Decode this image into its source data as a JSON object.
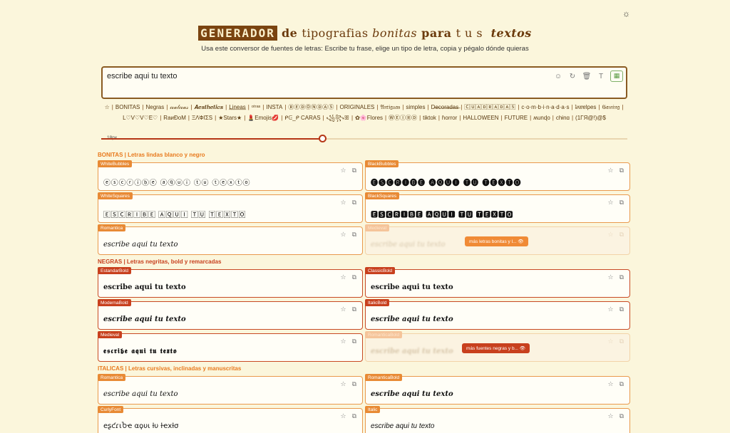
{
  "theme_icon": "☼",
  "header": {
    "title_boxed": "GENERADOR",
    "title_de": " de ",
    "title_tipografias": "tipografias ",
    "title_bonitas": "bonitas",
    "title_para": " para ",
    "title_tus": "tus",
    "title_textos": " textos",
    "subtitle": "Usa este conversor de fuentes de letras: Escribe tu frase, elige un tipo de letra, copia y pégalo dónde quieras"
  },
  "input": {
    "value": "escribe aqui tu texto",
    "tools": [
      "☺",
      "↻",
      "🗑",
      "T",
      "▦"
    ]
  },
  "categories": [
    "☆",
    "BONITAS",
    "Negras",
    "𝒾𝒸𝒶𝓁𝒾𝒸𝒶𝓈",
    "𝑨𝒆𝒔𝒕𝒉𝒆𝒕𝒊𝒄𝒔",
    "L̲i̲n̲e̲a̲s̲",
    "ᵒᵗʳᵃˢ",
    "INSTA",
    "ⓇⒺⒹⓄⓃⒹⒶⓈ",
    "ORIGINALES",
    "𝔄𝔫𝔱𝔦𝔤𝔲𝔞𝔰",
    "simples",
    "D̶e̶c̶o̶r̶a̶d̶a̶s̶",
    "🄲🅄🄰🄳🅁🄰🄳🄰🅂",
    "c·o·m·b·i·n·a·d·a·s",
    "ʇʌɐɐlpes",
    "𝔊𝔞𝔪𝔦𝔫𝔤",
    "L♡V♡V♡E♡",
    "RaиÐoM",
    "ΞΛ̇ФΙ̇ΣS",
    "★Stars★",
    "💄Emojis💋",
    "ᑭᕮ_ᑭ CARAS",
    "꧁꧂ꕥ",
    "✿🌸Flores",
    "ⓌⒺⒾⓇⒹ",
    "tiktok",
    "ɦorror",
    "HALLOWEEN",
    "FUTURE",
    "ʍunɖo",
    "chɨnɑ",
    "(1ΓЯ@!)@$"
  ],
  "slider": {
    "label": "18px",
    "value": 18,
    "fraction": 0.42
  },
  "sections": {
    "bonitas": "BONITAS | Letras lindas blanco y negro",
    "negras": "NEGRAS | Letras negritas, bold y remarcadas",
    "italicas": "ITALICAS | Letras cursivas, inclinadas y manuscritas"
  },
  "cards": {
    "white_bubbles": {
      "name": "WhiteBubbles",
      "text": "ⓔⓢⓒⓡⓘⓑⓔ ⓐⓠⓤⓘ ⓣⓤ ⓣⓔⓧⓣⓞ"
    },
    "black_bubbles": {
      "name": "BlackBubbles",
      "text": "🅔🅢🅒🅡🅘🅑🅔 🅐🅠🅤🅘 🅣🅤 🅣🅔🅧🅣🅞"
    },
    "white_squares": {
      "name": "WhiteSquares",
      "text": "🄴🅂🄲🅁🄸🄱🄴 🄰🅀🅄🄸 🅃🅄 🅃🄴🅇🅃🄾"
    },
    "black_squares": {
      "name": "BlackSquares",
      "text": "🅴🆂🅲🆁🅸🅱🅴 🅰🆀🆄🅸 🆃🆄 🆃🅴🆇🆃🅾"
    },
    "romantica_1": {
      "name": "Romantica",
      "text": "escribe aqui tu texto"
    },
    "locked_1": {
      "name": "Medieval",
      "text": "escribe aqui tu texto"
    },
    "locked_1_pill": "más letras bonitas y l... 👁",
    "estandar_bold": {
      "name": "EstandarBold",
      "text": "escribe aqui tu texto"
    },
    "classic_bold": {
      "name": "ClassicBold",
      "text": "escribe aqui tu texto"
    },
    "moderna_bold": {
      "name": "ModernaBold",
      "text": "escribe aqui tu texto"
    },
    "italic_bold": {
      "name": "ItalicBold",
      "text": "escribe aqui tu texto"
    },
    "medieval": {
      "name": "Medieval",
      "text": "𝖊𝖘𝖈𝖗𝖎𝖇𝖊 𝖆𝖖𝖚𝖎 𝖙𝖚 𝖙𝖊𝖝𝖙𝖔"
    },
    "locked_2": {
      "name": "RomanticaBold",
      "text": "escribe aqui tu texto"
    },
    "locked_2_pill": "más fuentes negras y b... 👁",
    "romantica_2": {
      "name": "Romantica",
      "text": "escribe aqui tu texto"
    },
    "romantica_bold": {
      "name": "RomanticaBold",
      "text": "escribe aqui tu texto"
    },
    "curly_font": {
      "name": "CurlyFont",
      "text": "eʂƈɾιႦҽ αϙυι ƚυ ƚҽxƚσ"
    },
    "italic": {
      "name": "Italic",
      "text": "escribe aqui tu texto"
    }
  },
  "card_icons": {
    "star": "☆",
    "copy": "⧉"
  },
  "colors": {
    "background": "#fbf6dc",
    "accent_orange": "#e88a35",
    "accent_red": "#c8401e",
    "brown": "#7a4410"
  }
}
